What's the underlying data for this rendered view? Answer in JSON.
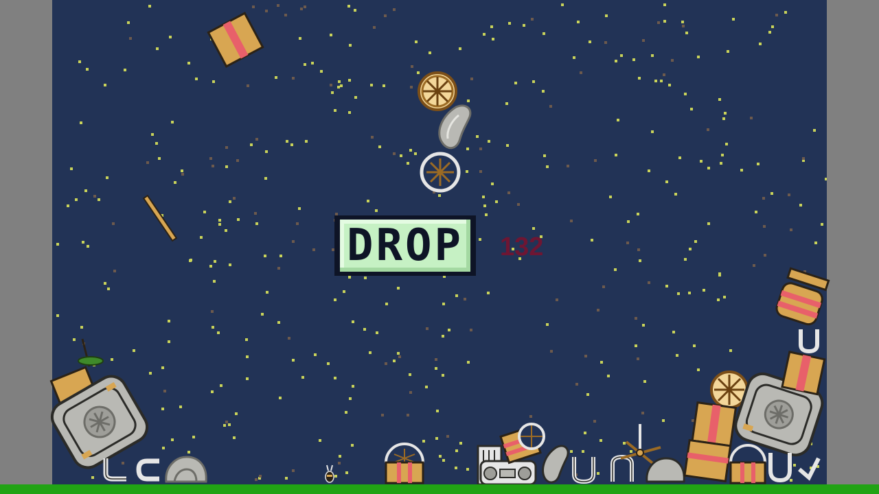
{
  "game": {
    "drop_button_label": "DROP",
    "counter": "132"
  },
  "colors": {
    "sky": "#223356",
    "side_bars": "#808080",
    "ground": "#21a314",
    "button_face": "#c6f1c4",
    "button_text": "#0e1426",
    "counter_text": "#6e1633",
    "star_yellow": "#c9d35a",
    "star_brown": "#6d5a4d",
    "crate": "#d8a652",
    "crate_stripe": "#e8606a",
    "stone": "#b9b9b4",
    "wheel_rim": "#9c6b24"
  },
  "objects": {
    "falling": [
      "crate-icon",
      "wheel-icon",
      "stone-icon",
      "white-wheel-icon",
      "plank-icon"
    ],
    "pile": [
      "crate-icon",
      "basket-icon",
      "stone-icon",
      "magnet-icon",
      "machine-icon",
      "fan-icon",
      "radio-icon",
      "plant-icon",
      "bug-icon"
    ]
  }
}
